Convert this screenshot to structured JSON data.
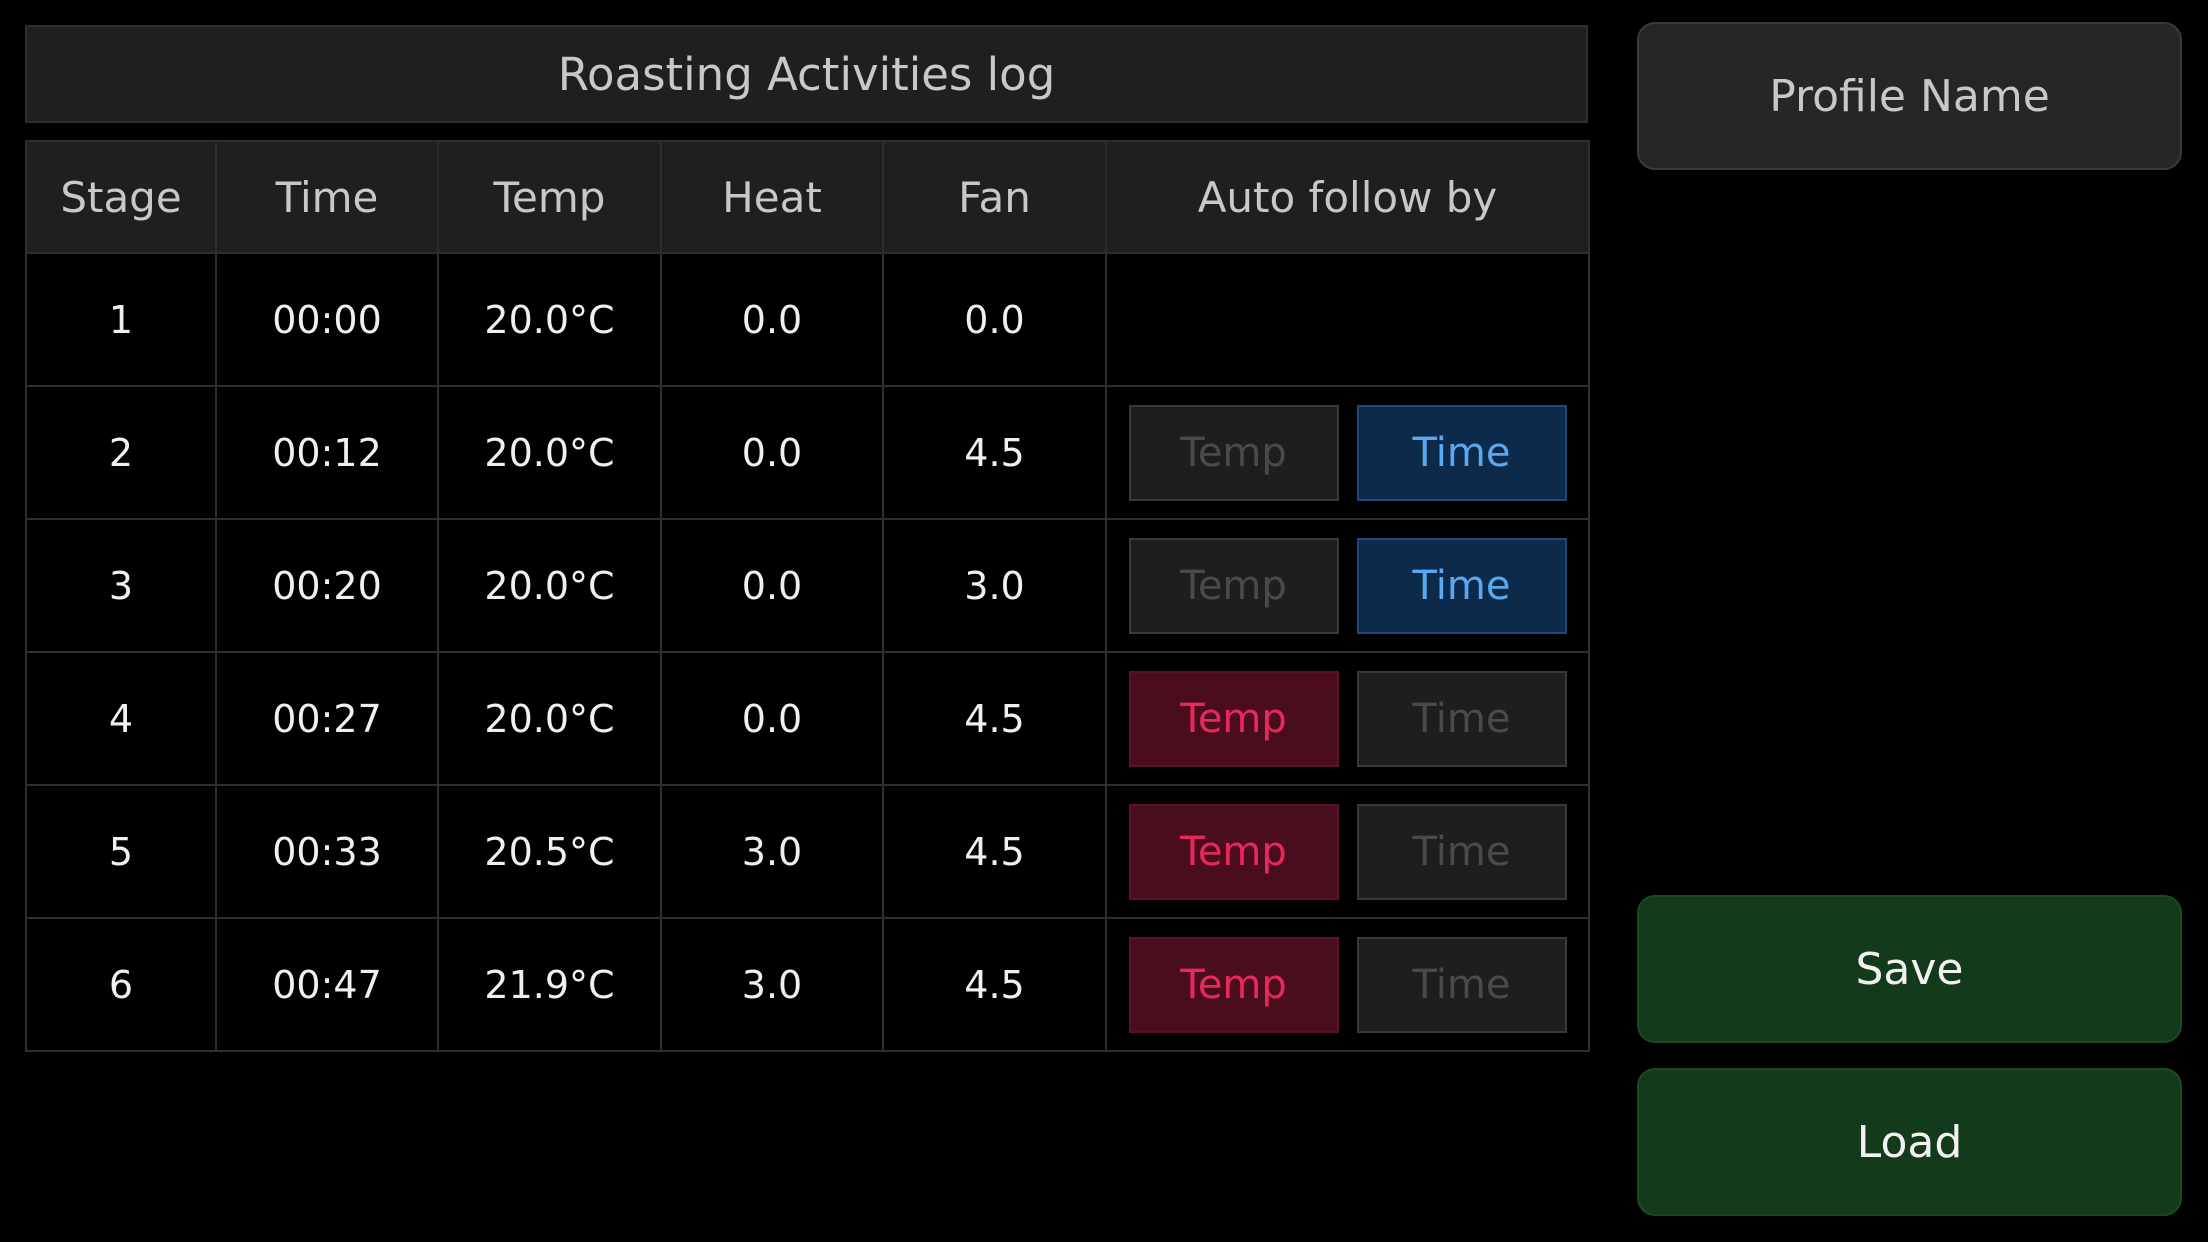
{
  "title": "Roasting Activities log",
  "columns": [
    "Stage",
    "Time",
    "Temp",
    "Heat",
    "Fan",
    "Auto follow by"
  ],
  "rows": [
    {
      "stage": "1",
      "time": "00:00",
      "temp": "20.0°C",
      "heat": "0.0",
      "fan": "0.0",
      "follow": null
    },
    {
      "stage": "2",
      "time": "00:12",
      "temp": "20.0°C",
      "heat": "0.0",
      "fan": "4.5",
      "follow": "Time"
    },
    {
      "stage": "3",
      "time": "00:20",
      "temp": "20.0°C",
      "heat": "0.0",
      "fan": "3.0",
      "follow": "Time"
    },
    {
      "stage": "4",
      "time": "00:27",
      "temp": "20.0°C",
      "heat": "0.0",
      "fan": "4.5",
      "follow": "Temp"
    },
    {
      "stage": "5",
      "time": "00:33",
      "temp": "20.5°C",
      "heat": "3.0",
      "fan": "4.5",
      "follow": "Temp"
    },
    {
      "stage": "6",
      "time": "00:47",
      "temp": "21.9°C",
      "heat": "3.0",
      "fan": "4.5",
      "follow": "Temp"
    }
  ],
  "follow_options": {
    "temp_label": "Temp",
    "time_label": "Time"
  },
  "sidebar": {
    "profile_name_label": "Profile Name",
    "save_label": "Save",
    "load_label": "Load"
  },
  "colors": {
    "time_active": "#5aa8ef",
    "temp_active": "#e8285a",
    "save_load_bg": "#133a1a"
  }
}
